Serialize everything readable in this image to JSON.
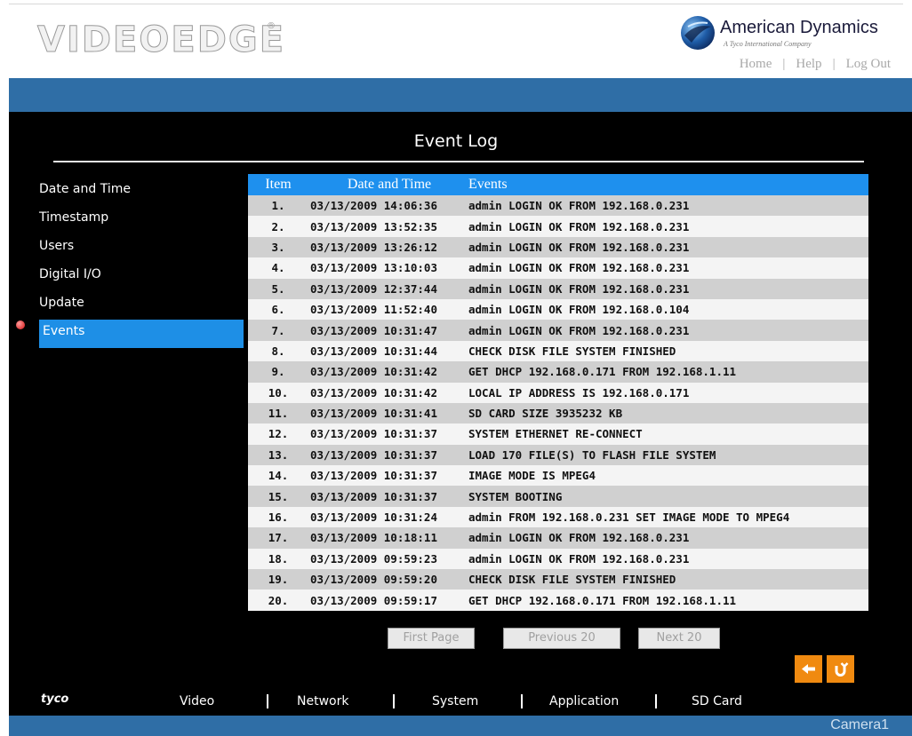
{
  "header": {
    "logo": "VIDEOEDGE",
    "logo_mark": "®",
    "brand_name": "American Dynamics",
    "brand_sub": "A Tyco International Company",
    "links": [
      "Home",
      "Help",
      "Log Out"
    ]
  },
  "page_title": "Event Log",
  "sidebar": {
    "items": [
      {
        "label": "Date and Time"
      },
      {
        "label": "Timestamp"
      },
      {
        "label": "Users"
      },
      {
        "label": "Digital I/O"
      },
      {
        "label": "Update"
      },
      {
        "label": "Events"
      }
    ],
    "active": "Events"
  },
  "table": {
    "headers": [
      "Item",
      "Date and Time",
      "Events"
    ],
    "rows": [
      {
        "item": "1.",
        "date": "03/13/2009 14:06:36",
        "event": "admin LOGIN OK FROM 192.168.0.231"
      },
      {
        "item": "2.",
        "date": "03/13/2009 13:52:35",
        "event": "admin LOGIN OK FROM 192.168.0.231"
      },
      {
        "item": "3.",
        "date": "03/13/2009 13:26:12",
        "event": "admin LOGIN OK FROM 192.168.0.231"
      },
      {
        "item": "4.",
        "date": "03/13/2009 13:10:03",
        "event": "admin LOGIN OK FROM 192.168.0.231"
      },
      {
        "item": "5.",
        "date": "03/13/2009 12:37:44",
        "event": "admin LOGIN OK FROM 192.168.0.231"
      },
      {
        "item": "6.",
        "date": "03/13/2009 11:52:40",
        "event": "admin LOGIN OK FROM 192.168.0.104"
      },
      {
        "item": "7.",
        "date": "03/13/2009 10:31:47",
        "event": "admin LOGIN OK FROM 192.168.0.231"
      },
      {
        "item": "8.",
        "date": "03/13/2009 10:31:44",
        "event": "CHECK DISK FILE SYSTEM FINISHED"
      },
      {
        "item": "9.",
        "date": "03/13/2009 10:31:42",
        "event": "GET DHCP 192.168.0.171 FROM 192.168.1.11"
      },
      {
        "item": "10.",
        "date": "03/13/2009 10:31:42",
        "event": "LOCAL IP ADDRESS IS 192.168.0.171"
      },
      {
        "item": "11.",
        "date": "03/13/2009 10:31:41",
        "event": "SD CARD SIZE 3935232 KB"
      },
      {
        "item": "12.",
        "date": "03/13/2009 10:31:37",
        "event": "SYSTEM ETHERNET RE-CONNECT"
      },
      {
        "item": "13.",
        "date": "03/13/2009 10:31:37",
        "event": "LOAD 170 FILE(S) TO FLASH FILE SYSTEM"
      },
      {
        "item": "14.",
        "date": "03/13/2009 10:31:37",
        "event": "IMAGE MODE IS MPEG4"
      },
      {
        "item": "15.",
        "date": "03/13/2009 10:31:37",
        "event": "SYSTEM BOOTING"
      },
      {
        "item": "16.",
        "date": "03/13/2009 10:31:24",
        "event": "admin FROM 192.168.0.231 SET IMAGE MODE TO MPEG4"
      },
      {
        "item": "17.",
        "date": "03/13/2009 10:18:11",
        "event": "admin LOGIN OK FROM 192.168.0.231"
      },
      {
        "item": "18.",
        "date": "03/13/2009 09:59:23",
        "event": "admin LOGIN OK FROM 192.168.0.231"
      },
      {
        "item": "19.",
        "date": "03/13/2009 09:59:20",
        "event": "CHECK DISK FILE SYSTEM FINISHED"
      },
      {
        "item": "20.",
        "date": "03/13/2009 09:59:17",
        "event": "GET DHCP 192.168.0.171 FROM 192.168.1.11"
      }
    ]
  },
  "pager": {
    "first": "First Page",
    "previous": "Previous 20",
    "next": "Next 20"
  },
  "actions": {
    "back_icon": "arrow-left-icon",
    "refresh_icon": "refresh-icon"
  },
  "footer": {
    "brand": "tyco",
    "nav": [
      "Video",
      "Network",
      "System",
      "Application",
      "SD Card"
    ],
    "camera": "Camera1"
  },
  "colors": {
    "accent_blue": "#1e90ee",
    "bar_blue": "#2f6ea6",
    "orange": "#f08a10",
    "panel_bg": "#000000"
  }
}
